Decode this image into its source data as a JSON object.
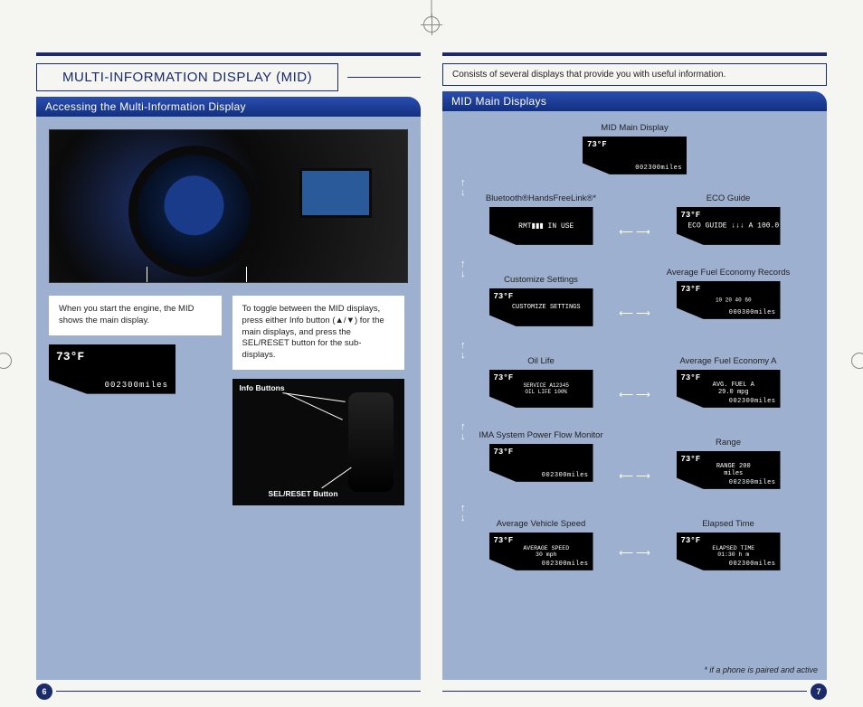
{
  "title": "MULTI-INFORMATION DISPLAY (MID)",
  "description": "Consists of several displays that provide you with useful information.",
  "left": {
    "section_header": "Accessing the Multi-Information Display",
    "box1": "When you start the engine, the MID shows the main display.",
    "box2": "To toggle between the MID displays, press either Info button (▲/▼) for the main displays, and press the SEL/RESET button for the sub-displays.",
    "screen_temp": "73°F",
    "screen_odo": "002300miles",
    "info_buttons_label": "Info Buttons",
    "sel_reset_label": "SEL/RESET Button",
    "page_number": "6"
  },
  "right": {
    "section_header": "MID Main Displays",
    "footnote": "* if a phone is paired and active",
    "page_number": "7",
    "items": {
      "top": {
        "label": "MID Main Display",
        "temp": "73°F",
        "odo": "002300miles",
        "center": ""
      },
      "l1": {
        "label": "Bluetooth®HandsFreeLink®*",
        "temp": "",
        "odo": "",
        "center": "RMT▮▮▮  IN USE"
      },
      "r1": {
        "label": "ECO Guide",
        "temp": "73°F",
        "odo": "",
        "center": "ECO GUIDE ↓↓↓ A 100.0"
      },
      "l2": {
        "label": "Customize Settings",
        "temp": "73°F",
        "odo": "",
        "center": "CUSTOMIZE SETTINGS"
      },
      "r2": {
        "label": "Average Fuel Economy Records",
        "temp": "73°F",
        "odo": "000300miles",
        "center": "10 20 40 60"
      },
      "l3": {
        "label": "Oil Life",
        "temp": "73°F",
        "odo": "",
        "center": "SERVICE A12345 OIL LIFE 100%"
      },
      "r3": {
        "label": "Average Fuel Economy A",
        "temp": "73°F",
        "odo": "002300miles",
        "center": "AVG. FUEL A 29.0 mpg"
      },
      "l4": {
        "label": "IMA System Power Flow Monitor",
        "temp": "73°F",
        "odo": "002300miles",
        "center": ""
      },
      "r4": {
        "label": "Range",
        "temp": "73°F",
        "odo": "002300miles",
        "center": "RANGE 200 miles"
      },
      "l5": {
        "label": "Average Vehicle Speed",
        "temp": "73°F",
        "odo": "002300miles",
        "center": "AVERAGE SPEED 30 mph"
      },
      "r5": {
        "label": "Elapsed Time",
        "temp": "73°F",
        "odo": "002300miles",
        "center": "ELAPSED TIME 01:30 h m"
      }
    }
  }
}
